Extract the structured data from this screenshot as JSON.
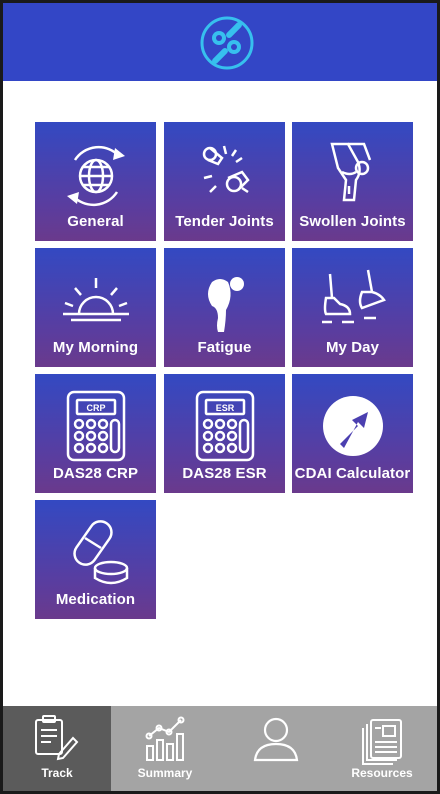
{
  "header": {
    "logo_icon": "joint-logo-icon",
    "color": "#3346c6"
  },
  "tiles": [
    {
      "label": "General",
      "icon": "globe-refresh-icon"
    },
    {
      "label": "Tender Joints",
      "icon": "tender-joint-icon"
    },
    {
      "label": "Swollen Joints",
      "icon": "swollen-knee-icon"
    },
    {
      "label": "My Morning",
      "icon": "sunrise-icon"
    },
    {
      "label": "Fatigue",
      "icon": "fatigue-figure-icon"
    },
    {
      "label": "My Day",
      "icon": "walking-shoes-icon"
    },
    {
      "label": "DAS28 CRP",
      "icon": "calculator-crp-icon",
      "badge": "CRP"
    },
    {
      "label": "DAS28 ESR",
      "icon": "calculator-esr-icon",
      "badge": "ESR"
    },
    {
      "label": "CDAI Calculator",
      "icon": "arrow-circle-icon"
    },
    {
      "label": "Medication",
      "icon": "pill-icon"
    }
  ],
  "tabs": [
    {
      "label": "Track",
      "icon": "clipboard-pen-icon",
      "active": true
    },
    {
      "label": "Summary",
      "icon": "chart-icon",
      "active": false
    },
    {
      "label": "",
      "icon": "user-icon",
      "active": false
    },
    {
      "label": "Resources",
      "icon": "documents-icon",
      "active": false
    }
  ],
  "colors": {
    "tile_top": "#3349c2",
    "tile_bottom": "#6a3a8c",
    "tabbar": "#a4a4a4",
    "tab_active": "#5b5b5b"
  }
}
